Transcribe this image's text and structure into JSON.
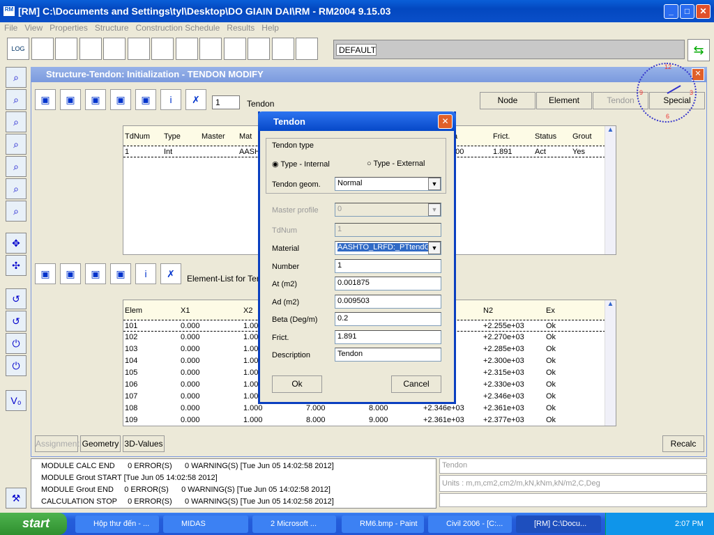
{
  "window": {
    "title": "[RM] C:\\Documents and Settings\\tyl\\Desktop\\DO GIAIN DAI\\RM -  RM2004 9.15.03",
    "icon": "rm-logo-icon"
  },
  "menu": [
    "File",
    "View",
    "Properties",
    "Structure",
    "Construction Schedule",
    "Results",
    "Help"
  ],
  "toolbar": {
    "combo": "DEFAULT",
    "first_label": "LOG"
  },
  "child": {
    "title": "Structure-Tendon: Initialization - TENDON MODIFY",
    "tendon_number": "1",
    "tendon_label": "Tendon",
    "buttons": [
      "Node",
      "Element",
      "Tendon",
      "Special"
    ],
    "element_list_label": "Element-List for Tend",
    "bottom_buttons": [
      "Assignment",
      "Geometry",
      "3D-Values"
    ],
    "recalc": "Recalc"
  },
  "clock": {
    "time": "2:07"
  },
  "tendon_table": {
    "headers": [
      "TdNum",
      "Type",
      "Master",
      "Mat",
      "ta",
      "Frict.",
      "Status",
      "Grout"
    ],
    "rows": [
      [
        "1",
        "Int",
        "",
        "AASH",
        "200",
        "1.891",
        "Act",
        "Yes"
      ]
    ]
  },
  "element_table": {
    "headers": [
      "Elem",
      "X1",
      "X2",
      "",
      "",
      "",
      "N2",
      "Ex"
    ],
    "rows": [
      [
        "101",
        "0.000",
        "1.000",
        "",
        "",
        "",
        "+2.255e+03",
        "Ok"
      ],
      [
        "102",
        "0.000",
        "1.000",
        "",
        "",
        "",
        "+2.270e+03",
        "Ok"
      ],
      [
        "103",
        "0.000",
        "1.000",
        "",
        "",
        "",
        "+2.285e+03",
        "Ok"
      ],
      [
        "104",
        "0.000",
        "1.000",
        "",
        "",
        "",
        "+2.300e+03",
        "Ok"
      ],
      [
        "105",
        "0.000",
        "1.000",
        "",
        "",
        "",
        "+2.315e+03",
        "Ok"
      ],
      [
        "106",
        "0.000",
        "1.000",
        "",
        "",
        "",
        "+2.330e+03",
        "Ok"
      ],
      [
        "107",
        "0.000",
        "1.000",
        "",
        "",
        "",
        "+2.346e+03",
        "Ok"
      ],
      [
        "108",
        "0.000",
        "1.000",
        "7.000",
        "8.000",
        "+2.346e+03",
        "+2.361e+03",
        "Ok"
      ],
      [
        "109",
        "0.000",
        "1.000",
        "8.000",
        "9.000",
        "+2.361e+03",
        "+2.377e+03",
        "Ok"
      ]
    ]
  },
  "dialog": {
    "title": "Tendon",
    "group": "Tendon type",
    "radio_internal": "Type - Internal",
    "radio_external": "Type - External",
    "internal_selected": true,
    "fields": [
      {
        "label": "Tendon geom.",
        "value": "Normal",
        "dropdown": true,
        "disabled": false
      },
      {
        "label": "Master profile",
        "value": "0",
        "dropdown": true,
        "disabled": true
      },
      {
        "label": "TdNum",
        "value": "1",
        "dropdown": false,
        "disabled": true
      },
      {
        "label": "Material",
        "value": "AASHTO_LRFD:_PTtendG",
        "dropdown": true,
        "disabled": false,
        "selected": true
      },
      {
        "label": "Number",
        "value": "1",
        "dropdown": false,
        "disabled": false
      },
      {
        "label": "At (m2)",
        "value": "0.001875",
        "dropdown": false,
        "disabled": false
      },
      {
        "label": "Ad (m2)",
        "value": "0.009503",
        "dropdown": false,
        "disabled": false
      },
      {
        "label": "Beta (Deg/m)",
        "value": "0.2",
        "dropdown": false,
        "disabled": false
      },
      {
        "label": "Frict.",
        "value": "1.891",
        "dropdown": false,
        "disabled": false
      },
      {
        "label": "Description",
        "value": "Tendon",
        "dropdown": false,
        "disabled": false
      }
    ],
    "ok": "Ok",
    "cancel": "Cancel"
  },
  "log": [
    "MODULE CALC END      0 ERROR(S)      0 WARNING(S) [Tue Jun 05 14:02:58 2012]",
    "MODULE Grout START [Tue Jun 05 14:02:58 2012]",
    "MODULE Grout END     0 ERROR(S)      0 WARNING(S) [Tue Jun 05 14:02:58 2012]",
    "CALCULATION STOP     0 ERROR(S)      0 WARNING(S) [Tue Jun 05 14:02:58 2012]"
  ],
  "status": {
    "line1": "Tendon",
    "line2": "Units : m,m,cm2,cm2/m,kN,kNm,kN/m2,C,Deg",
    "line3": ""
  },
  "taskbar": {
    "start": "start",
    "items": [
      "Hộp thư đến - ...",
      "MIDAS",
      "2 Microsoft ...",
      "RM6.bmp - Paint",
      "Civil 2006 - [C:...",
      "[RM] C:\\Docu..."
    ],
    "time": "2:07 PM"
  }
}
